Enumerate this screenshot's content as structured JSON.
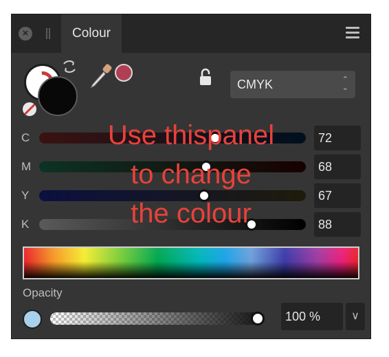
{
  "panel": {
    "tab_label": "Colour",
    "close_symbol": "×",
    "icons": [
      "close-icon",
      "grip-icon",
      "menu-icon",
      "swap-icon",
      "no-colour-icon",
      "colour-picker-icon",
      "lock-icon"
    ],
    "fill_colour": "#080808",
    "picked_colour": "#b13f53"
  },
  "model_select": {
    "value": "CMYK",
    "arrows_up": "⌃",
    "arrows_down": "⌄"
  },
  "sliders": [
    {
      "label": "C",
      "value": "72",
      "fraction": 0.72,
      "gradient": [
        "#3a1212",
        "#00101e"
      ]
    },
    {
      "label": "M",
      "value": "68",
      "fraction": 0.68,
      "gradient": [
        "#0c3324",
        "#170000"
      ]
    },
    {
      "label": "Y",
      "value": "67",
      "fraction": 0.67,
      "gradient": [
        "#0b1040",
        "#1e1b0b"
      ]
    },
    {
      "label": "K",
      "value": "88",
      "fraction": 0.88,
      "gradient": [
        "#5a5a5a",
        "#000000"
      ]
    }
  ],
  "opacity": {
    "label": "Opacity",
    "value": "100 %",
    "fraction": 1.0,
    "swatch_colour": "#a8d1ec",
    "dropdown_symbol": "∨"
  },
  "annotation": {
    "line1": "Use thispanel",
    "line2": "to change",
    "line3": "the colour",
    "colour": "#e8423b"
  }
}
